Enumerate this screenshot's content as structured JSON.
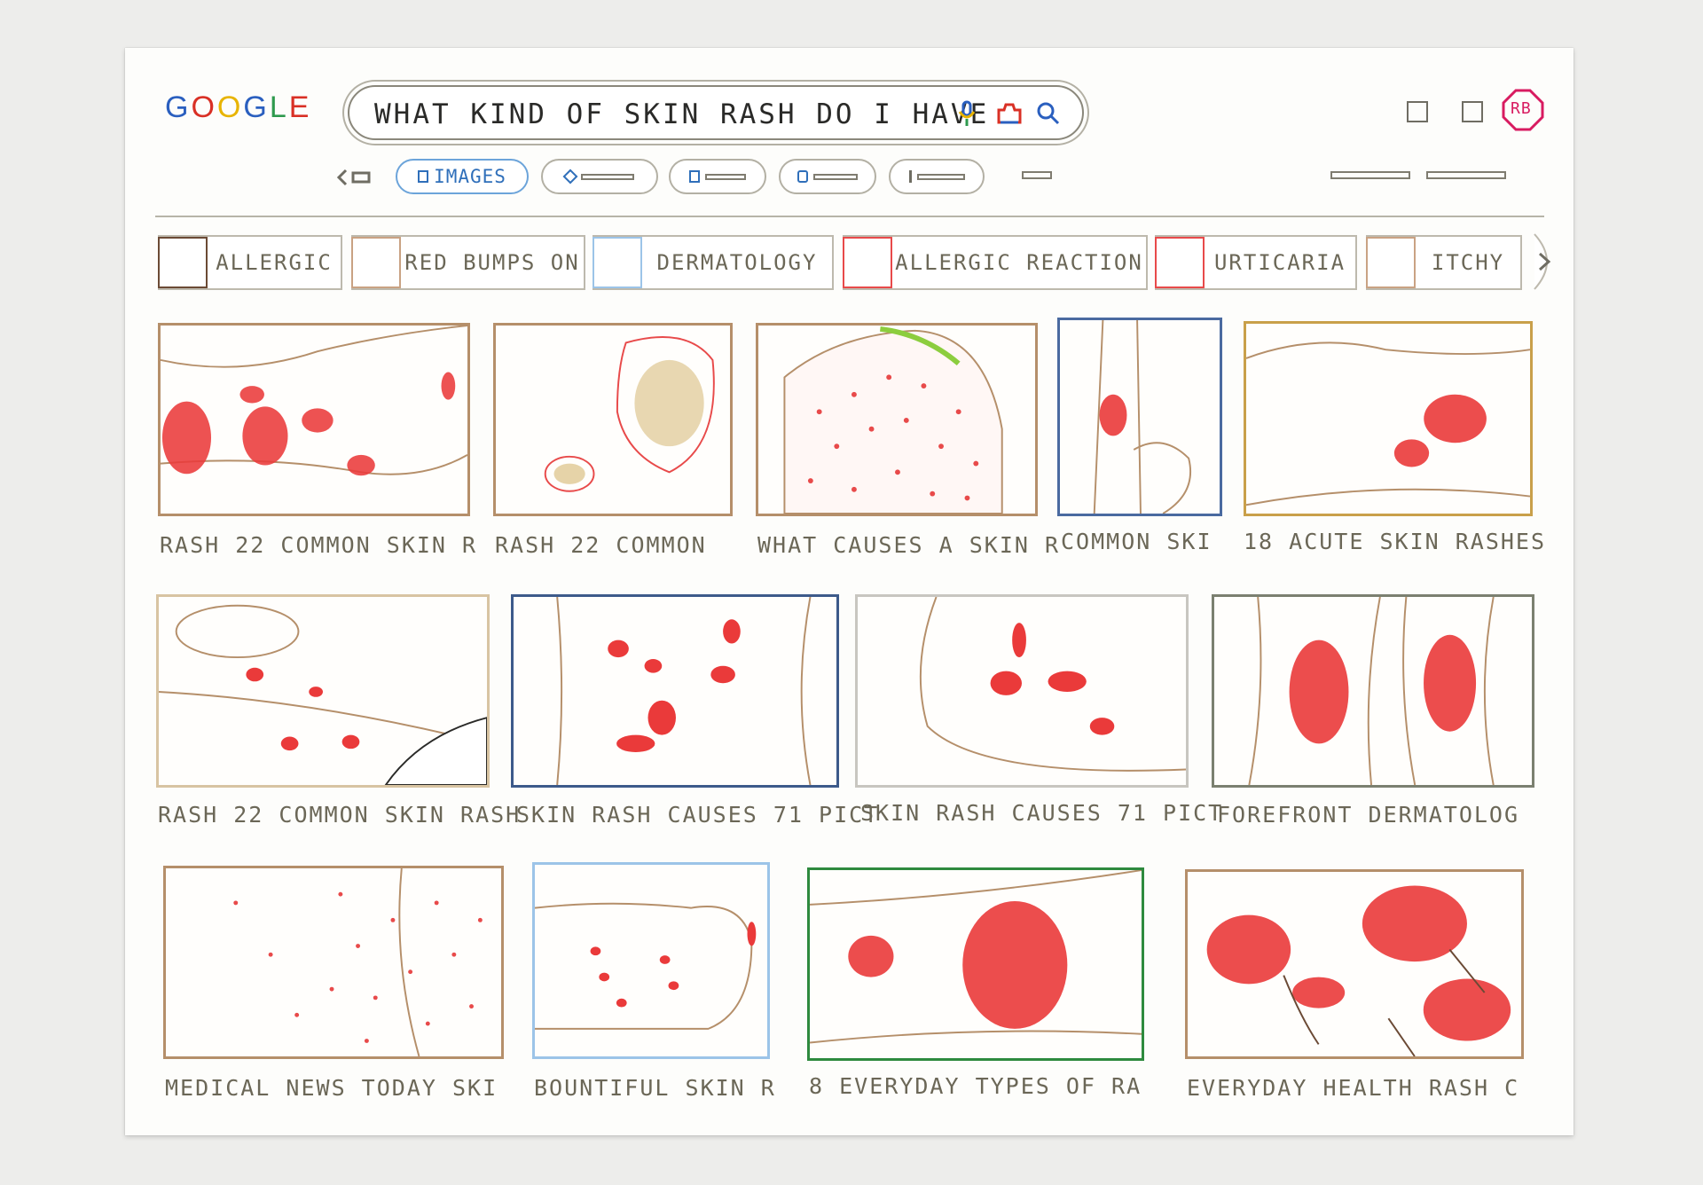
{
  "logo": {
    "letters": [
      "G",
      "O",
      "O",
      "G",
      "L",
      "E"
    ],
    "colors": [
      "#2a5fbf",
      "#d93025",
      "#e8b400",
      "#2a5fbf",
      "#2e9a4e",
      "#d93025"
    ]
  },
  "search": {
    "query": "WHAT KIND OF SKIN RASH DO I HAVE",
    "icons": [
      "microphone-icon",
      "camera-icon",
      "search-icon"
    ]
  },
  "header": {
    "avatar_initials": "RB",
    "icons": [
      "square-icon",
      "square-icon"
    ]
  },
  "tabs": [
    {
      "label": "IMAGES",
      "active": true
    },
    {
      "label": "",
      "active": false
    },
    {
      "label": "",
      "active": false
    },
    {
      "label": "",
      "active": false
    },
    {
      "label": "",
      "active": false
    }
  ],
  "chips": [
    {
      "label": "ALLERGIC",
      "color": "#6b4a35"
    },
    {
      "label": "RED BUMPS ON",
      "color": "#c9a283"
    },
    {
      "label": "DERMATOLOGY",
      "color": "#9cc4e8"
    },
    {
      "label": "ALLERGIC REACTION",
      "color": "#e84a4a"
    },
    {
      "label": "URTICARIA",
      "color": "#e84a4a"
    },
    {
      "label": "ITCHY",
      "color": "#c9a283"
    }
  ],
  "results": [
    {
      "caption": "RASH 22 COMMON SKIN R",
      "border": "#b58f6a"
    },
    {
      "caption": "RASH 22 COMMON",
      "border": "#b58f6a"
    },
    {
      "caption": "WHAT CAUSES A SKIN R",
      "border": "#b58f6a"
    },
    {
      "caption": "COMMON SKI",
      "border": "#4a6aa0"
    },
    {
      "caption": "18 ACUTE SKIN RASHES",
      "border": "#c9a04a"
    },
    {
      "caption": "RASH 22 COMMON SKIN RASH",
      "border": "#d8c4a2"
    },
    {
      "caption": "SKIN RASH CAUSES 71 PICT",
      "border": "#3d5a8a"
    },
    {
      "caption": "SKIN RASH CAUSES 71 PICT",
      "border": "#c8c6c0"
    },
    {
      "caption": "FOREFRONT DERMATOLOG",
      "border": "#7b8070"
    },
    {
      "caption": "MEDICAL NEWS TODAY SKI",
      "border": "#b58f6a"
    },
    {
      "caption": "BOUNTIFUL SKIN R",
      "border": "#9cc4e8"
    },
    {
      "caption": "8 EVERYDAY TYPES OF RA",
      "border": "#2e8a3e"
    },
    {
      "caption": "EVERYDAY HEALTH RASH C",
      "border": "#b58f6a"
    }
  ]
}
